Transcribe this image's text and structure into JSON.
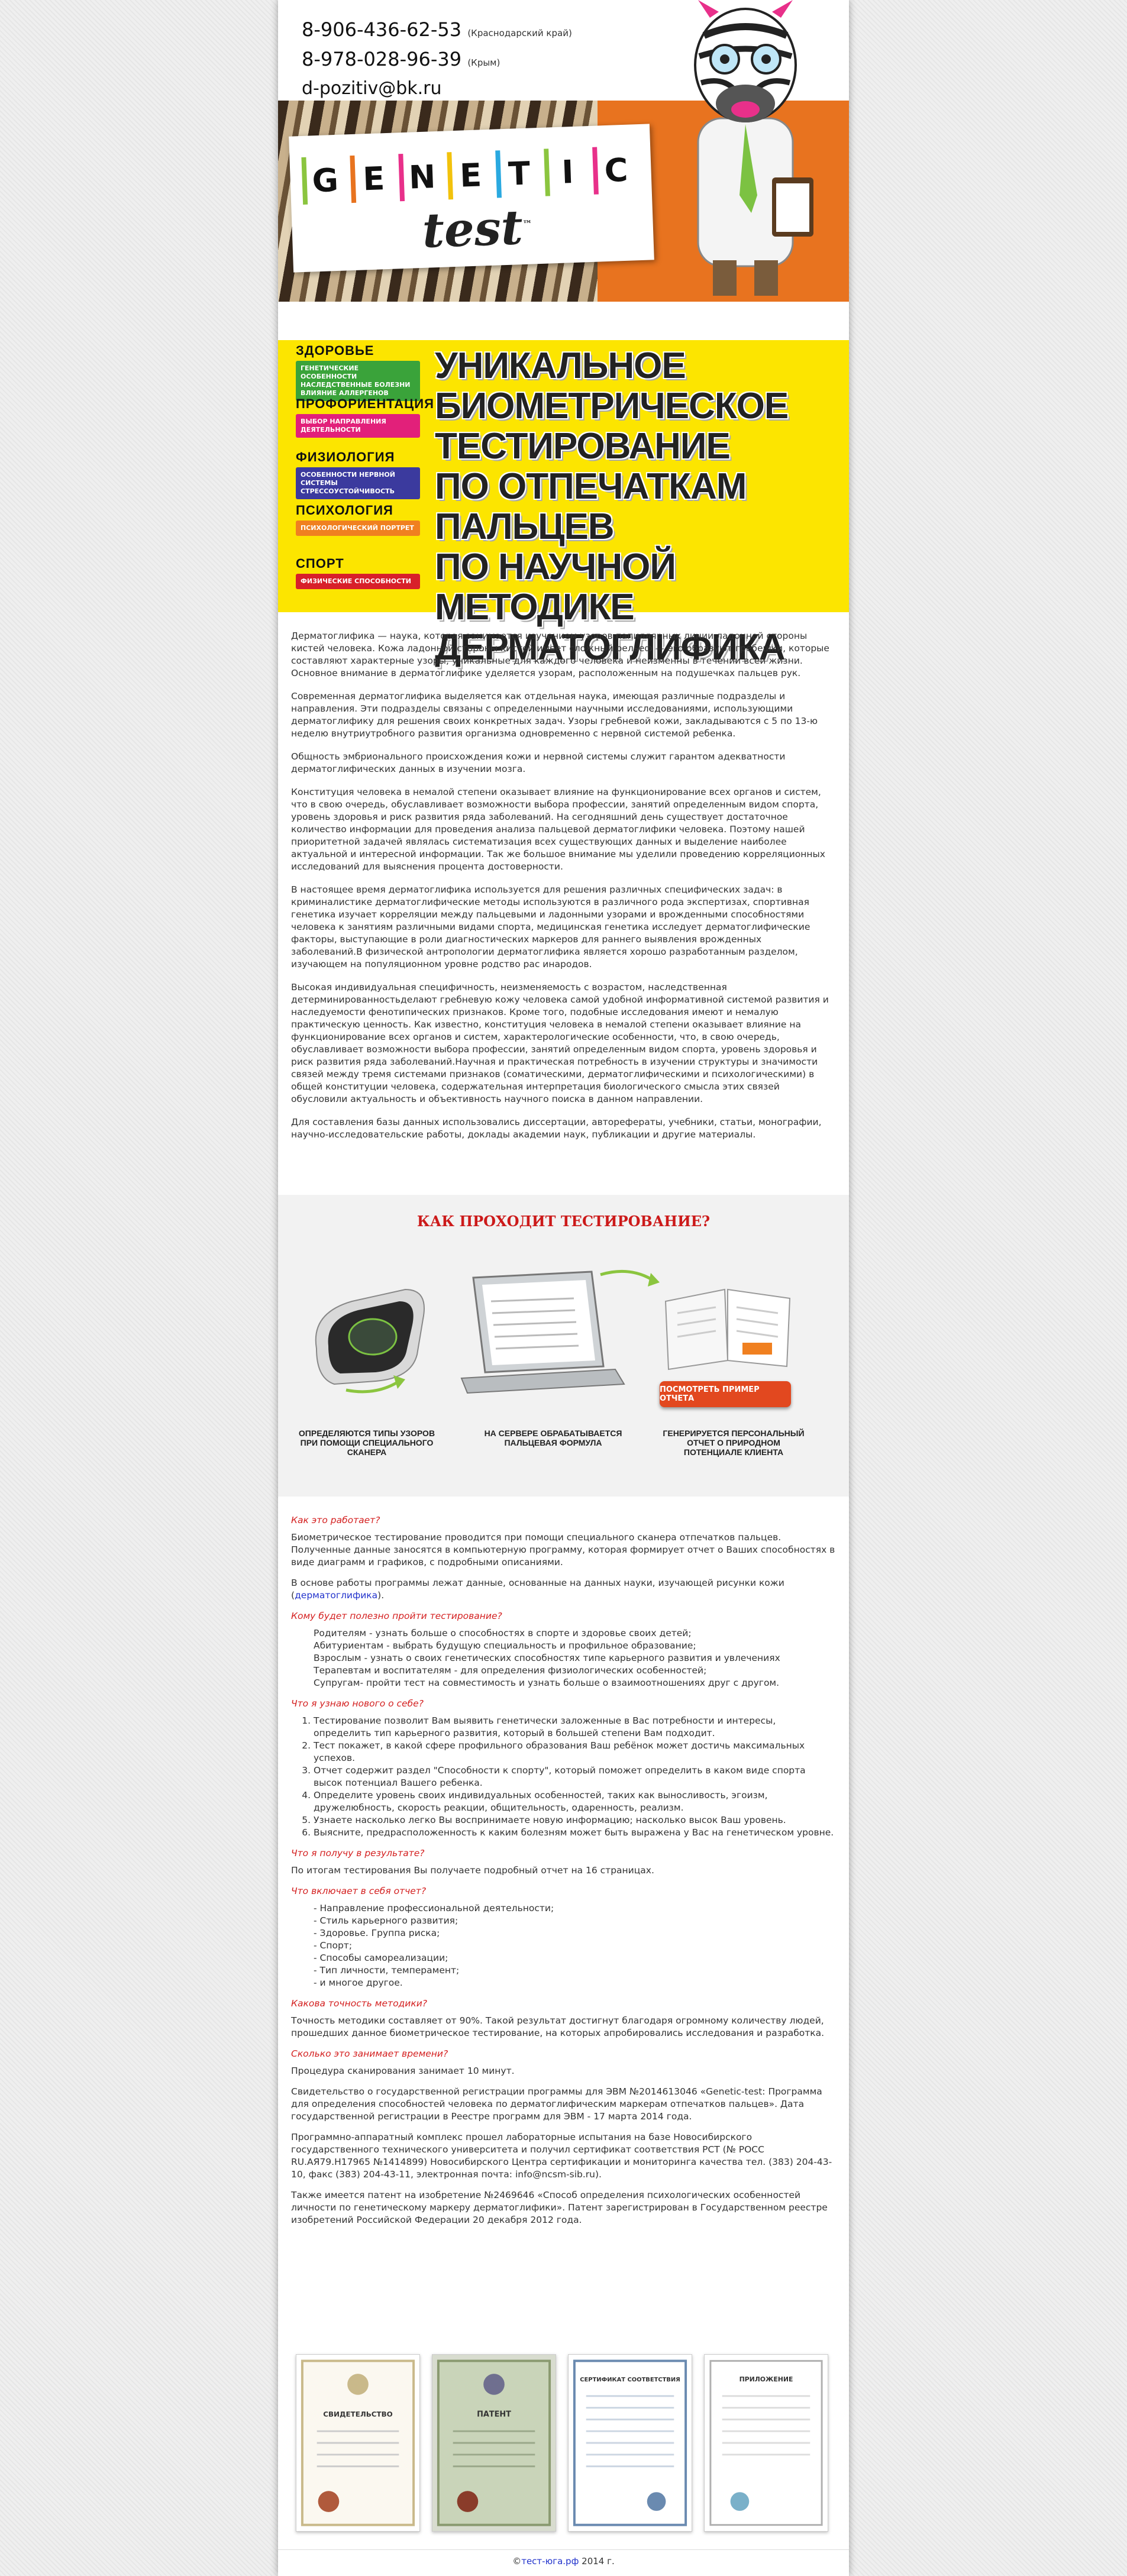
{
  "header": {
    "phones": [
      {
        "number": "8-906-436-62-53",
        "region": "(Краснодарский край)"
      },
      {
        "number": "8-978-028-96-39",
        "region": "(Крым)"
      }
    ],
    "email": "d-pozitiv@bk.ru"
  },
  "logo": {
    "letters": [
      "G",
      "E",
      "N",
      "E",
      "T",
      "I",
      "C"
    ],
    "letter_colors": [
      "#8bc53f",
      "#e8731f",
      "#e8308a",
      "#f2c20c",
      "#2aa9e0",
      "#8bc53f",
      "#e8308a"
    ],
    "sub": "test",
    "tm": "™"
  },
  "categories": [
    {
      "title": "ЗДОРОВЬЕ",
      "color": "#3aa33a",
      "lines": [
        "ГЕНЕТИЧЕСКИЕ ОСОБЕННОСТИ",
        "НАСЛЕДСТВЕННЫЕ БОЛЕЗНИ",
        "ВЛИЯНИЕ АЛЛЕРГЕНОВ"
      ]
    },
    {
      "title": "ПРОФОРИЕНТАЦИЯ",
      "color": "#e2207a",
      "lines": [
        "ВЫБОР НАПРАВЛЕНИЯ",
        "ДЕЯТЕЛЬНОСТИ"
      ]
    },
    {
      "title": "ФИЗИОЛОГИЯ",
      "color": "#3b3a9e",
      "lines": [
        "ОСОБЕННОСТИ НЕРВНОЙ СИСТЕМЫ",
        "СТРЕССОУСТОЙЧИВОСТЬ"
      ]
    },
    {
      "title": "ПСИХОЛОГИЯ",
      "color": "#f08020",
      "lines": [
        "ПСИХОЛОГИЧЕСКИЙ ПОРТРЕТ"
      ]
    },
    {
      "title": "СПОРТ",
      "color": "#d8202a",
      "lines": [
        "ФИЗИЧЕСКИЕ СПОСОБНОСТИ"
      ]
    }
  ],
  "headline": [
    "УНИКАЛЬНОЕ",
    "БИОМЕТРИЧЕСКОЕ",
    "ТЕСТИРОВАНИЕ",
    "ПО ОТПЕЧАТКАМ ПАЛЬЦЕВ",
    "ПО НАУЧНОЙ МЕТОДИКЕ",
    "ДЕРМАТОГЛИФИКА"
  ],
  "article": [
    "Дерматоглифика — наука, которая занимается изучением узоров папиллярных линии ладонной стороны кистей человека. Кожа ладонной стороны кистей имеет сложный рельеф — его образуют гребешки, которые составляют характерные узоры, уникальные для каждого человека и неизменны в течении всей жизни. Основное внимание в дерматоглифике уделяется узорам, расположенным на подушечках пальцев рук.",
    "Современная дерматоглифика выделяется как отдельная наука, имеющая различные подразделы и направления. Эти подразделы связаны с определенными научными исследованиями, использующими дерматоглифику для решения своих конкретных задач. Узоры гребневой кожи, закладываются с 5 по 13-ю неделю внутриутробного развития организма одновременно с нервной системой ребенка.",
    "Общность эмбрионального происхождения кожи и нервной системы служит гарантом адекватности дерматоглифических данных в изучении мозга.",
    "Конституция человека в немалой степени оказывает влияние на функционирование всех органов и систем, что в свою очередь, обуславливает возможности выбора профессии, занятий определенным видом спорта, уровень здоровья и риск развития ряда заболеваний. На сегодняшний день существует достаточное количество информации для проведения анализа пальцевой дерматоглифики человека. Поэтому нашей приоритетной задачей являлась систематизация всех существующих данных и выделение наиболее актуальной и интересной информации. Так же большое внимание мы уделили проведению корреляционных исследований для выяснения процента достоверности.",
    "В настоящее время дерматоглифика используется для решения различных специфических задач: в криминалистике дерматоглифические методы используются в различного рода экспертизах, спортивная генетика изучает корреляции между пальцевыми и ладонными узорами и врожденными способностями человека к занятиям различными видами спорта, медицинская генетика исследует дерматоглифические факторы, выступающие в роли диагностических маркеров для раннего выявления врожденных заболеваний.В физической антропологии дерматоглифика является хорошо разработанным разделом, изучающем на популяционном уровне родство рас инародов.",
    "Высокая индивидуальная специфичность, неизменяемость с возрастом, наследственная детерминированностьделают гребневую кожу человека самой удобной информативной системой развития и наследуемости фенотипических признаков. Кроме того, подобные исследования имеют и немалую практическую ценность. Как известно, конституция человека в немалой степени оказывает влияние на функционирование всех органов и систем, характерологические особенности, что, в свою очередь, обуславливает возможности выбора профессии, занятий определенным видом спорта, уровень здоровья и риск развития ряда заболеваний.Научная и практическая потребность в изучении структуры и значимости связей между тремя системами признаков (соматическими, дерматоглифическими и психологическими) в общей конституции человека, содержательная интерпретация биологического смысла этих связей обусловили актуальность и объективность научного поиска в данном направлении.",
    "Для составления базы данных использовались диссертации, авторефераты, учебники, статьи, монографии, научно-исследовательские работы, доклады академии наук, публикации и другие материалы."
  ],
  "how": {
    "title": "КАК ПРОХОДИТ ТЕСТИРОВАНИЕ?",
    "steps": [
      "ОПРЕДЕЛЯЮТСЯ ТИПЫ УЗОРОВ ПРИ ПОМОЩИ СПЕЦИАЛЬНОГО СКАНЕРА",
      "НА СЕРВЕРЕ ОБРАБАТЫВАЕТСЯ ПАЛЬЦЕВАЯ ФОРМУЛА",
      "ГЕНЕРИРУЕТСЯ ПЕРСОНАЛЬНЫЙ ОТЧЕТ О ПРИРОДНОМ ПОТЕНЦИАЛЕ КЛИЕНТА"
    ],
    "report_button": "ПОСМОТРЕТЬ ПРИМЕР ОТЧЕТА"
  },
  "faq": {
    "q1": "Как это работает?",
    "a1": "Биометрическое тестирование проводится при помощи специального сканера отпечатков пальцев. Полученные данные заносятся в компьютерную программу, которая формирует отчет о Ваших способностях в виде диаграмм и графиков, с подробными описаниями.",
    "a1b_pre": "В основе работы программы лежат данные, основанные на данных науки, изучающей рисунки кожи (",
    "a1b_link": "дерматоглифика",
    "a1b_post": ").",
    "q2": "Кому будет полезно пройти тестирование?",
    "a2": [
      "Родителям - узнать больше о способностях в спорте и здоровье своих детей;",
      "Абитуриентам - выбрать будущую специальность и профильное образование;",
      "Взрослым - узнать о своих генетических способностях типе карьерного развития и увлечениях",
      "Терапевтам и воспитателям - для определения физиологических особенностей;",
      "Супругам- пройти тест на совместимость и узнать больше о взаимоотношениях друг с другом."
    ],
    "q3": "Что я узнаю нового о себе?",
    "a3": [
      "Тестирование позволит Вам выявить генетически заложенные в Вас потребности и интересы, определить тип карьерного развития, который в большей степени Вам подходит.",
      "Тест покажет, в какой сфере профильного образования Ваш ребёнок может достичь максимальных успехов.",
      "Отчет содержит раздел \"Способности к спорту\", который поможет определить в каком виде спорта высок потенциал Вашего ребенка.",
      "Определите уровень своих индивидуальных особенностей, таких как выносливость, эгоизм, дружелюбность, скорость реакции, общительность, одаренность, реализм.",
      "Узнаете насколько легко Вы воспринимаете новую информацию; насколько высок Ваш уровень.",
      "Выясните, предрасположенность к каким болезням может быть выражена у Вас на генетическом уровне."
    ],
    "q4": "Что я получу в результате?",
    "a4": "По итогам тестирования Вы получаете подробный отчет на 16 страницах.",
    "q5": "Что включает в себя отчет?",
    "a5": [
      "- Направление профессиональной деятельности;",
      "- Стиль карьерного развития;",
      "- Здоровье. Группа риска;",
      "- Спорт;",
      "- Способы самореализации;",
      "- Тип личности, темперамент;",
      "- и многое другое."
    ],
    "q6": "Какова точность методики?",
    "a6": "Точность методики составляет от 90%. Такой результат достигнут благодаря огромному количеству людей, прошедших данное биометрическое тестирование, на которых апробировались исследования и разработка.",
    "q7": "Сколько это занимает времени?",
    "a7": "Процедура сканирования занимает 10 минут.",
    "p1": "Свидетельство о государственной регистрации программы для ЭВМ №2014613046 «Genetic-test: Программа для определения способностей человека по дерматоглифическим маркерам отпечатков пальцев». Дата государственной регистрации в Реестре программ для ЭВМ - 17 марта 2014 года.",
    "p2": "Программно-аппаратный комплекс прошел лабораторные испытания на базе Новосибирского государственного технического университета и получил сертификат соответствия РСТ (№ РОСС RU.АЯ79.Н17965 №1414899) Новосибирского Центра сертификации и мониторинга качества тел. (383) 204-43-10, факс (383) 204-43-11, электронная почта: info@ncsm-sib.ru).",
    "p3": "Также имеется патент на изобретение №2469646 «Способ определения психологических особенностей личности по генетическому маркеру дерматоглифики». Патент зарегистрирован в Государственном реестре изобретений Российской Федерации 20 декабря 2012 года."
  },
  "certs": [
    "СВИДЕТЕЛЬСТВО",
    "ПАТЕНТ",
    "СЕРТИФИКАТ СООТВЕТСТВИЯ",
    "ПРИЛОЖЕНИЕ"
  ],
  "footer": {
    "copy": "©",
    "site": "тест-юга.рф",
    "year": " 2014 г."
  }
}
